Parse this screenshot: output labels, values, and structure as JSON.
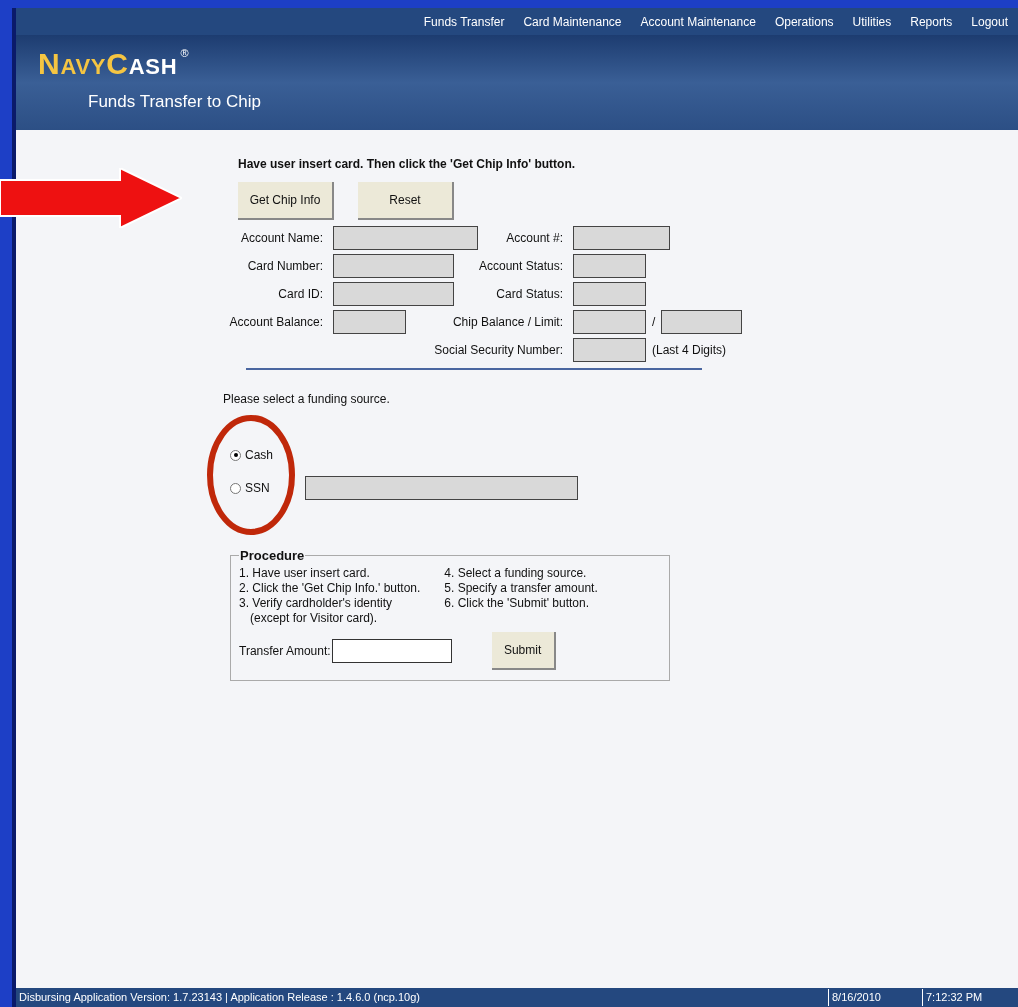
{
  "nav": [
    "Funds Transfer",
    "Card Maintenance",
    "Account Maintenance",
    "Operations",
    "Utilities",
    "Reports",
    "Logout"
  ],
  "header": {
    "logo_first": "N",
    "logo_small": "AVY",
    "logo_second": "C",
    "logo_small2": "ASH",
    "registered": "®",
    "subtitle": "Funds Transfer to Chip"
  },
  "instruction": "Have user insert card. Then click the 'Get Chip Info' button.",
  "buttons": [
    "Get Chip Info",
    "Reset"
  ],
  "rows": [
    {
      "left": {
        "label": "Account Name:"
      },
      "right": {
        "label": "Account #:"
      }
    },
    {
      "left": {
        "label": "Card Number:"
      },
      "right": {
        "label": "Account Status:"
      }
    },
    {
      "left": {
        "label": "Card ID:"
      },
      "right": {
        "label": "Card Status:"
      }
    },
    {
      "left": {
        "label": "Account Balance:"
      },
      "right": {
        "label": "Chip Balance / Limit:",
        "separator": "/"
      }
    },
    {
      "right": {
        "label": "Social Security Number:",
        "note": "(Last 4 Digits)"
      }
    }
  ],
  "funding": {
    "prompt": "Please select a funding source.",
    "options": [
      {
        "label": "Cash",
        "selected": true
      },
      {
        "label": "SSN",
        "selected": false,
        "has_field": true
      }
    ]
  },
  "procedure": {
    "title": "Procedure",
    "columns": [
      [
        "1. Have user insert card.",
        "2. Click the 'Get Chip Info.' button.",
        "3. Verify cardholder's identity",
        "(except for Visitor card)."
      ],
      [
        "4. Select a funding source.",
        "5. Specify a transfer amount.",
        "6. Click the 'Submit' button."
      ]
    ],
    "amount_label": "Transfer Amount:",
    "submit": "Submit"
  },
  "status_bar": {
    "version": "Disbursing Application Version:  1.7.23143  | Application Release : 1.4.6.0 (ncp.10g)",
    "date": "8/16/2010",
    "time": "7:12:32 PM"
  }
}
